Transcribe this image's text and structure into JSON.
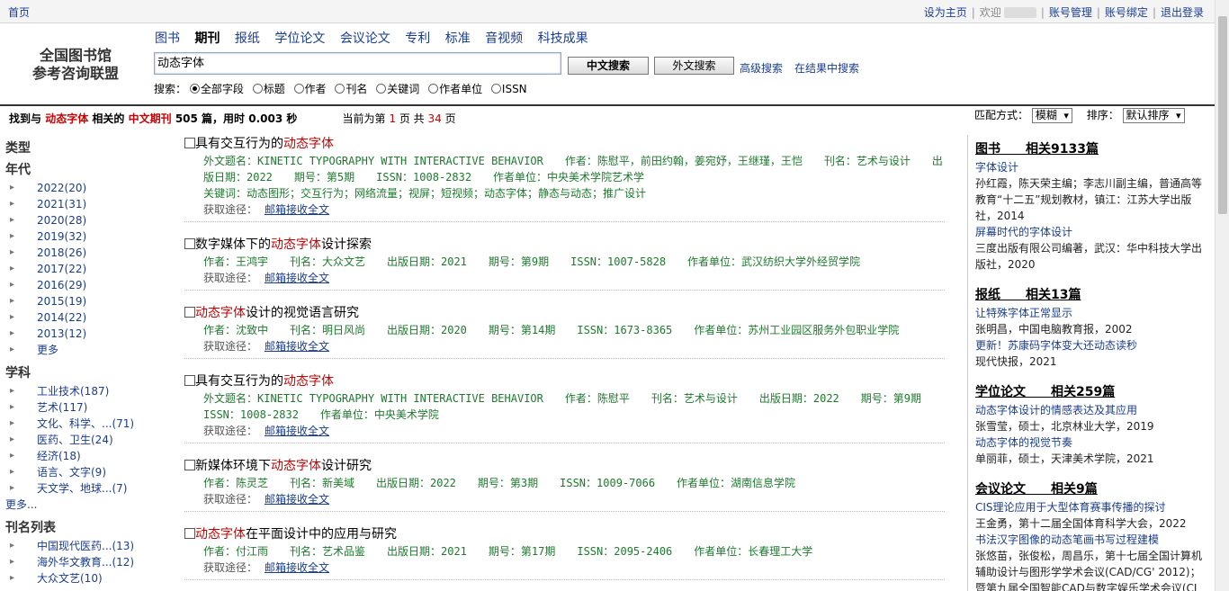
{
  "topbar": {
    "home": "首页",
    "set_home": "设为主页",
    "welcome": "欢迎",
    "account_manage": "账号管理",
    "account_bind": "账号绑定",
    "logout": "退出登录"
  },
  "logo": {
    "line1": "全国图书馆",
    "line2": "参考咨询联盟"
  },
  "nav_tabs": [
    "图书",
    "期刊",
    "报纸",
    "学位论文",
    "会议论文",
    "专利",
    "标准",
    "音视频",
    "科技成果"
  ],
  "active_tab": "期刊",
  "search": {
    "value": "动态字体",
    "btn_cn": "中文搜索",
    "btn_en": "外文搜索",
    "advanced": "高级搜索",
    "in_results": "在结果中搜索",
    "fields_label": "搜索：",
    "fields": [
      "全部字段",
      "标题",
      "作者",
      "刊名",
      "关键词",
      "作者单位",
      "ISSN"
    ]
  },
  "summary": {
    "p1": "找到与",
    "keyword": "动态字体",
    "p2": "相关的",
    "category": "中文期刊",
    "p3": "505 篇，用时 0.003 秒",
    "page_p1": "当前为第",
    "page_cur": "1",
    "page_p2": "页 共",
    "page_total": "34",
    "page_p3": "页"
  },
  "match": {
    "label": "匹配方式：",
    "value": "模糊",
    "sort_label": "排序：",
    "sort_value": "默认排序"
  },
  "facets": {
    "type_heading": "类型",
    "year_heading": "年代",
    "years": [
      "2022(20)",
      "2021(31)",
      "2020(28)",
      "2019(32)",
      "2018(26)",
      "2017(22)",
      "2016(29)",
      "2015(19)",
      "2014(22)",
      "2013(12)"
    ],
    "year_more": "更多",
    "subject_heading": "学科",
    "subjects": [
      "工业技术(187)",
      "艺术(117)",
      "文化、科学、...(71)",
      "医药、卫生(24)",
      "经济(18)",
      "语言、文字(9)",
      "天文学、地球...(7)"
    ],
    "subject_more": "更多...",
    "journal_heading": "刊名列表",
    "journals": [
      "中国现代医药...(13)",
      "海外华文教育...(12)",
      "大众文艺(10)"
    ]
  },
  "results": {
    "get_label": "获取途径：",
    "get_link": "邮箱接收全文",
    "items": [
      {
        "t_pre": "具有交互行为的",
        "t_hl": "动态字体",
        "t_post": "",
        "meta": "外文题名：KINETIC TYPOGRAPHY WITH INTERACTIVE BEHAVIOR　　作者：陈慰平，前田约翰，姜宛妤，王继瑾，王恺　　刊名：艺术与设计　　出版日期：2022　　期号：第5期　　ISSN：1008-2832　　作者单位：中央美术学院艺术学",
        "keywords": "关键词：动态图形；交互行为；网络流量；视屏；短视频；动态字体；静态与动态；推广设计"
      },
      {
        "t_pre": "数字媒体下的",
        "t_hl": "动态字体",
        "t_post": "设计探索",
        "meta": "作者：王鸿宇　　刊名：大众文艺　　出版日期：2021　　期号：第9期　　ISSN：1007-5828　　作者单位：武汉纺织大学外经贸学院",
        "keywords": ""
      },
      {
        "t_pre": "",
        "t_hl": "动态字体",
        "t_post": "设计的视觉语言研究",
        "meta": "作者：沈致中　　刊名：明日风尚　　出版日期：2020　　期号：第14期　　ISSN：1673-8365　　作者单位：苏州工业园区服务外包职业学院",
        "keywords": ""
      },
      {
        "t_pre": "具有交互行为的",
        "t_hl": "动态字体",
        "t_post": "",
        "meta": "外文题名：KINETIC TYPOGRAPHY WITH INTERACTIVE BEHAVIOR　　作者：陈慰平　　刊名：艺术与设计　　出版日期：2022　　期号：第9期　　ISSN：1008-2832　　作者单位：中央美术学院",
        "keywords": ""
      },
      {
        "t_pre": "新媒体环境下",
        "t_hl": "动态字体",
        "t_post": "设计研究",
        "meta": "作者：陈灵芝　　刊名：新美域　　出版日期：2022　　期号：第3期　　ISSN：1009-7066　　作者单位：湖南信息学院",
        "keywords": ""
      },
      {
        "t_pre": "",
        "t_hl": "动态字体",
        "t_post": "在平面设计中的应用与研究",
        "meta": "作者：付江雨　　刊名：艺术品鉴　　出版日期：2021　　期号：第17期　　ISSN：2095-2406　　作者单位：长春理工大学",
        "keywords": ""
      }
    ]
  },
  "related": {
    "books_heading": "图书　　相关9133篇",
    "books": [
      {
        "title": "字体设计",
        "desc": "孙红霞，陈天荣主编；李志川副主编，普通高等教育“十二五”规划教材，镇江：江苏大学出版社，2014"
      },
      {
        "title": "屏幕时代的字体设计",
        "desc": "三度出版有限公司编著，武汉：华中科技大学出版社，2020"
      }
    ],
    "news_heading": "报纸　　相关13篇",
    "news": [
      {
        "title": "让特殊字体正常显示",
        "desc": "张明昌，中国电脑教育报，2002"
      },
      {
        "title": "更新！苏康码字体变大还动态读秒",
        "desc": "现代快报，2021"
      }
    ],
    "thesis_heading": "学位论文　　相关259篇",
    "thesis": [
      {
        "title": "动态字体设计的情感表达及其应用",
        "desc": "张雪莹，硕士，北京林业大学，2019"
      },
      {
        "title": "动态字体的视觉节奏",
        "desc": "单丽菲，硕士，天津美术学院，2021"
      }
    ],
    "conf_heading": "会议论文　　相关9篇",
    "conf": [
      {
        "title": "CIS理论应用于大型体育赛事传播的探讨",
        "desc": "王金勇，第十二届全国体育科学大会，2022"
      },
      {
        "title": "书法汉字图像的动态笔画书写过程建模",
        "desc": "张悠苗，张俊松，周昌乐，第十七届全国计算机辅助设计与图形学学术会议(CAD/CG' 2012)；暨第九届全国智能CAD与数字娱乐学术会议(CI"
      }
    ]
  }
}
